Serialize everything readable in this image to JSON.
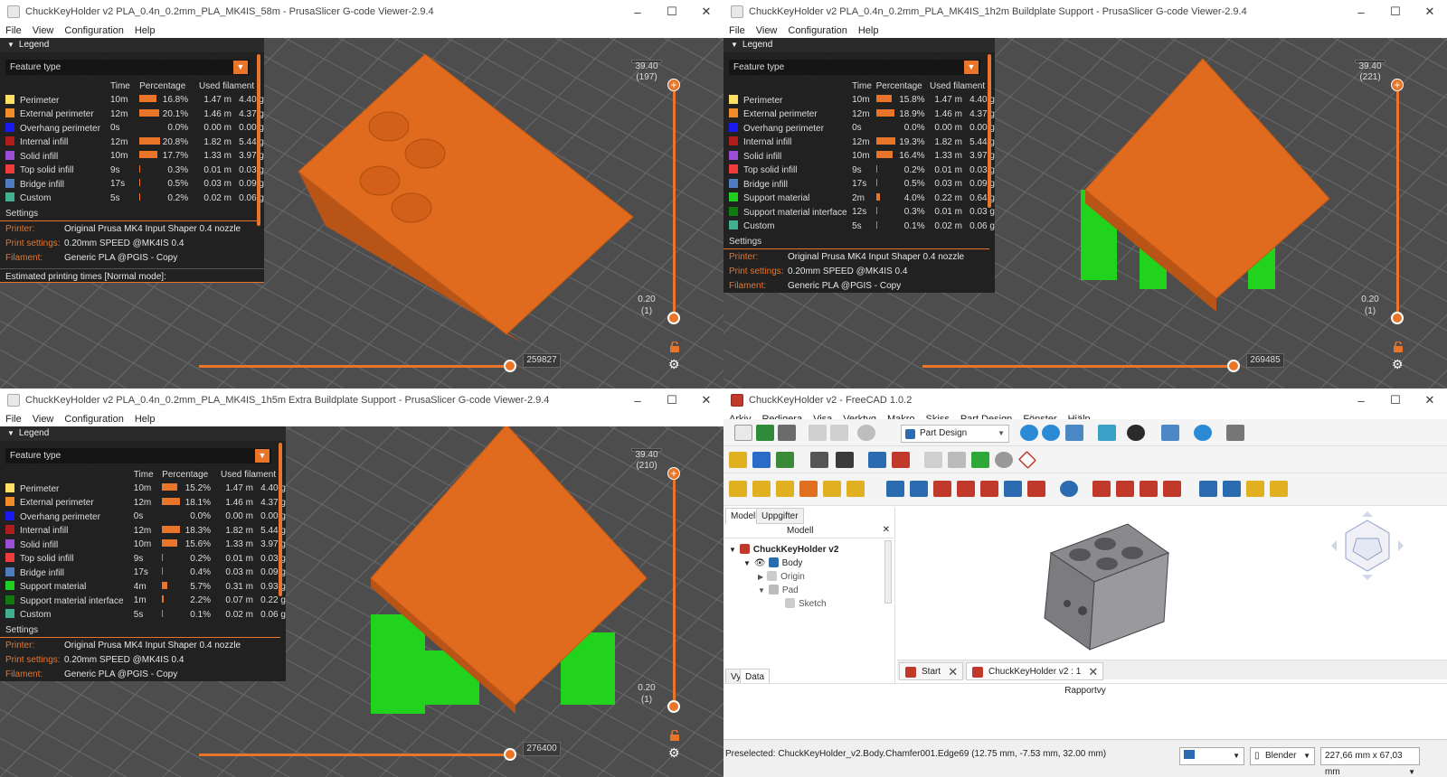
{
  "windows": [
    {
      "title": "ChuckKeyHolder v2 PLA_0.4n_0.2mm_PLA_MK4IS_58m - PrusaSlicer G-code Viewer-2.9.4",
      "menu": [
        "File",
        "View",
        "Configuration",
        "Help"
      ],
      "legend_title": "Legend",
      "feature_select": "Feature type",
      "headers": [
        "Time",
        "Percentage",
        "Used filament"
      ],
      "rows": [
        {
          "name": "Perimeter",
          "color": "#ffe066",
          "time": "10m",
          "pct": "16.8%",
          "pctv": 16.8,
          "len": "1.47 m",
          "g": "4.40 g"
        },
        {
          "name": "External perimeter",
          "color": "#f28c28",
          "time": "12m",
          "pct": "20.1%",
          "pctv": 20.1,
          "len": "1.46 m",
          "g": "4.37 g"
        },
        {
          "name": "Overhang perimeter",
          "color": "#1a1af0",
          "time": "0s",
          "pct": "0.0%",
          "pctv": 0,
          "len": "0.00 m",
          "g": "0.00 g"
        },
        {
          "name": "Internal infill",
          "color": "#b01b1b",
          "time": "12m",
          "pct": "20.8%",
          "pctv": 20.8,
          "len": "1.82 m",
          "g": "5.44 g"
        },
        {
          "name": "Solid infill",
          "color": "#9b4fd6",
          "time": "10m",
          "pct": "17.7%",
          "pctv": 17.7,
          "len": "1.33 m",
          "g": "3.97 g"
        },
        {
          "name": "Top solid infill",
          "color": "#f03c3c",
          "time": "9s",
          "pct": "0.3%",
          "pctv": 0.3,
          "len": "0.01 m",
          "g": "0.03 g"
        },
        {
          "name": "Bridge infill",
          "color": "#4f7ec0",
          "time": "17s",
          "pct": "0.5%",
          "pctv": 0.5,
          "len": "0.03 m",
          "g": "0.09 g"
        },
        {
          "name": "Custom",
          "color": "#40b090",
          "time": "5s",
          "pct": "0.2%",
          "pctv": 0.2,
          "len": "0.02 m",
          "g": "0.06 g"
        }
      ],
      "settings_label": "Settings",
      "settings": [
        {
          "k": "Printer:",
          "v": "Original Prusa MK4 Input Shaper 0.4 nozzle"
        },
        {
          "k": "Print settings:",
          "v": "0.20mm SPEED @MK4IS 0.4"
        },
        {
          "k": "Filament:",
          "v": "Generic PLA @PGIS - Copy"
        }
      ],
      "footer": "Estimated printing times [Normal mode]:",
      "top_val": "39.40",
      "top_layer": "(197)",
      "bot_val": "0.20",
      "bot_layer": "(1)",
      "hval": "259827"
    },
    {
      "title": "ChuckKeyHolder v2 PLA_0.4n_0.2mm_PLA_MK4IS_1h2m Buildplate Support - PrusaSlicer G-code Viewer-2.9.4",
      "menu": [
        "File",
        "View",
        "Configuration",
        "Help"
      ],
      "legend_title": "Legend",
      "feature_select": "Feature type",
      "headers": [
        "Time",
        "Percentage",
        "Used filament"
      ],
      "rows": [
        {
          "name": "Perimeter",
          "color": "#ffe066",
          "time": "10m",
          "pct": "15.8%",
          "pctv": 15.8,
          "len": "1.47 m",
          "g": "4.40 g"
        },
        {
          "name": "External perimeter",
          "color": "#f28c28",
          "time": "12m",
          "pct": "18.9%",
          "pctv": 18.9,
          "len": "1.46 m",
          "g": "4.37 g"
        },
        {
          "name": "Overhang perimeter",
          "color": "#1a1af0",
          "time": "0s",
          "pct": "0.0%",
          "pctv": 0,
          "len": "0.00 m",
          "g": "0.00 g"
        },
        {
          "name": "Internal infill",
          "color": "#b01b1b",
          "time": "12m",
          "pct": "19.3%",
          "pctv": 19.3,
          "len": "1.82 m",
          "g": "5.44 g"
        },
        {
          "name": "Solid infill",
          "color": "#9b4fd6",
          "time": "10m",
          "pct": "16.4%",
          "pctv": 16.4,
          "len": "1.33 m",
          "g": "3.97 g"
        },
        {
          "name": "Top solid infill",
          "color": "#f03c3c",
          "time": "9s",
          "pct": "0.2%",
          "pctv": 0.2,
          "len": "0.01 m",
          "g": "0.03 g"
        },
        {
          "name": "Bridge infill",
          "color": "#4f7ec0",
          "time": "17s",
          "pct": "0.5%",
          "pctv": 0.5,
          "len": "0.03 m",
          "g": "0.09 g"
        },
        {
          "name": "Support material",
          "color": "#1fd01f",
          "time": "2m",
          "pct": "4.0%",
          "pctv": 4.0,
          "len": "0.22 m",
          "g": "0.64 g"
        },
        {
          "name": "Support material interface",
          "color": "#127a12",
          "time": "12s",
          "pct": "0.3%",
          "pctv": 0.3,
          "len": "0.01 m",
          "g": "0.03 g"
        },
        {
          "name": "Custom",
          "color": "#40b090",
          "time": "5s",
          "pct": "0.1%",
          "pctv": 0.1,
          "len": "0.02 m",
          "g": "0.06 g"
        }
      ],
      "settings_label": "Settings",
      "settings": [
        {
          "k": "Printer:",
          "v": "Original Prusa MK4 Input Shaper 0.4 nozzle"
        },
        {
          "k": "Print settings:",
          "v": "0.20mm SPEED @MK4IS 0.4"
        },
        {
          "k": "Filament:",
          "v": "Generic PLA @PGIS - Copy"
        }
      ],
      "footer": "",
      "top_val": "39.40",
      "top_layer": "(221)",
      "bot_val": "0.20",
      "bot_layer": "(1)",
      "hval": "269485"
    },
    {
      "title": "ChuckKeyHolder v2 PLA_0.4n_0.2mm_PLA_MK4IS_1h5m Extra Buildplate Support - PrusaSlicer G-code Viewer-2.9.4",
      "menu": [
        "File",
        "View",
        "Configuration",
        "Help"
      ],
      "legend_title": "Legend",
      "feature_select": "Feature type",
      "headers": [
        "Time",
        "Percentage",
        "Used filament"
      ],
      "rows": [
        {
          "name": "Perimeter",
          "color": "#ffe066",
          "time": "10m",
          "pct": "15.2%",
          "pctv": 15.2,
          "len": "1.47 m",
          "g": "4.40 g"
        },
        {
          "name": "External perimeter",
          "color": "#f28c28",
          "time": "12m",
          "pct": "18.1%",
          "pctv": 18.1,
          "len": "1.46 m",
          "g": "4.37 g"
        },
        {
          "name": "Overhang perimeter",
          "color": "#1a1af0",
          "time": "0s",
          "pct": "0.0%",
          "pctv": 0,
          "len": "0.00 m",
          "g": "0.00 g"
        },
        {
          "name": "Internal infill",
          "color": "#b01b1b",
          "time": "12m",
          "pct": "18.3%",
          "pctv": 18.3,
          "len": "1.82 m",
          "g": "5.44 g"
        },
        {
          "name": "Solid infill",
          "color": "#9b4fd6",
          "time": "10m",
          "pct": "15.6%",
          "pctv": 15.6,
          "len": "1.33 m",
          "g": "3.97 g"
        },
        {
          "name": "Top solid infill",
          "color": "#f03c3c",
          "time": "9s",
          "pct": "0.2%",
          "pctv": 0.2,
          "len": "0.01 m",
          "g": "0.03 g"
        },
        {
          "name": "Bridge infill",
          "color": "#4f7ec0",
          "time": "17s",
          "pct": "0.4%",
          "pctv": 0.4,
          "len": "0.03 m",
          "g": "0.09 g"
        },
        {
          "name": "Support material",
          "color": "#1fd01f",
          "time": "4m",
          "pct": "5.7%",
          "pctv": 5.7,
          "len": "0.31 m",
          "g": "0.93 g"
        },
        {
          "name": "Support material interface",
          "color": "#127a12",
          "time": "1m",
          "pct": "2.2%",
          "pctv": 2.2,
          "len": "0.07 m",
          "g": "0.22 g"
        },
        {
          "name": "Custom",
          "color": "#40b090",
          "time": "5s",
          "pct": "0.1%",
          "pctv": 0.1,
          "len": "0.02 m",
          "g": "0.06 g"
        }
      ],
      "settings_label": "Settings",
      "settings": [
        {
          "k": "Printer:",
          "v": "Original Prusa MK4 Input Shaper 0.4 nozzle"
        },
        {
          "k": "Print settings:",
          "v": "0.20mm SPEED @MK4IS 0.4"
        },
        {
          "k": "Filament:",
          "v": "Generic PLA @PGIS - Copy"
        }
      ],
      "footer": "",
      "top_val": "39.40",
      "top_layer": "(210)",
      "bot_val": "0.20",
      "bot_layer": "(1)",
      "hval": "276400"
    }
  ],
  "freecad": {
    "title": "ChuckKeyHolder v2 - FreeCAD 1.0.2",
    "menu": [
      "Arkiv",
      "Redigera",
      "Visa",
      "Verktyg",
      "Makro",
      "Skiss",
      "Part Design",
      "Fönster",
      "Hjälp"
    ],
    "workbench": "Part Design",
    "tabs": [
      "Modell",
      "Uppgifter"
    ],
    "tree_header": "Modell",
    "tree": [
      "ChuckKeyHolder v2",
      "Body",
      "Origin",
      "Pad",
      "Sketch"
    ],
    "bottom_tabs": [
      "Vy",
      "Data"
    ],
    "doc_tabs": [
      "Start",
      "ChuckKeyHolder v2 : 1"
    ],
    "report_title": "Rapportvy",
    "status": "Preselected: ChuckKeyHolder_v2.Body.Chamfer001.Edge69 (12.75 mm, -7.53 mm, 32.00 mm)",
    "nav_style": "Blender",
    "dims": "227,66 mm x 67,03 mm"
  },
  "colors": {
    "accent": "#e8752a",
    "model_orange": "#e06a1e",
    "support_green": "#22d31e"
  }
}
